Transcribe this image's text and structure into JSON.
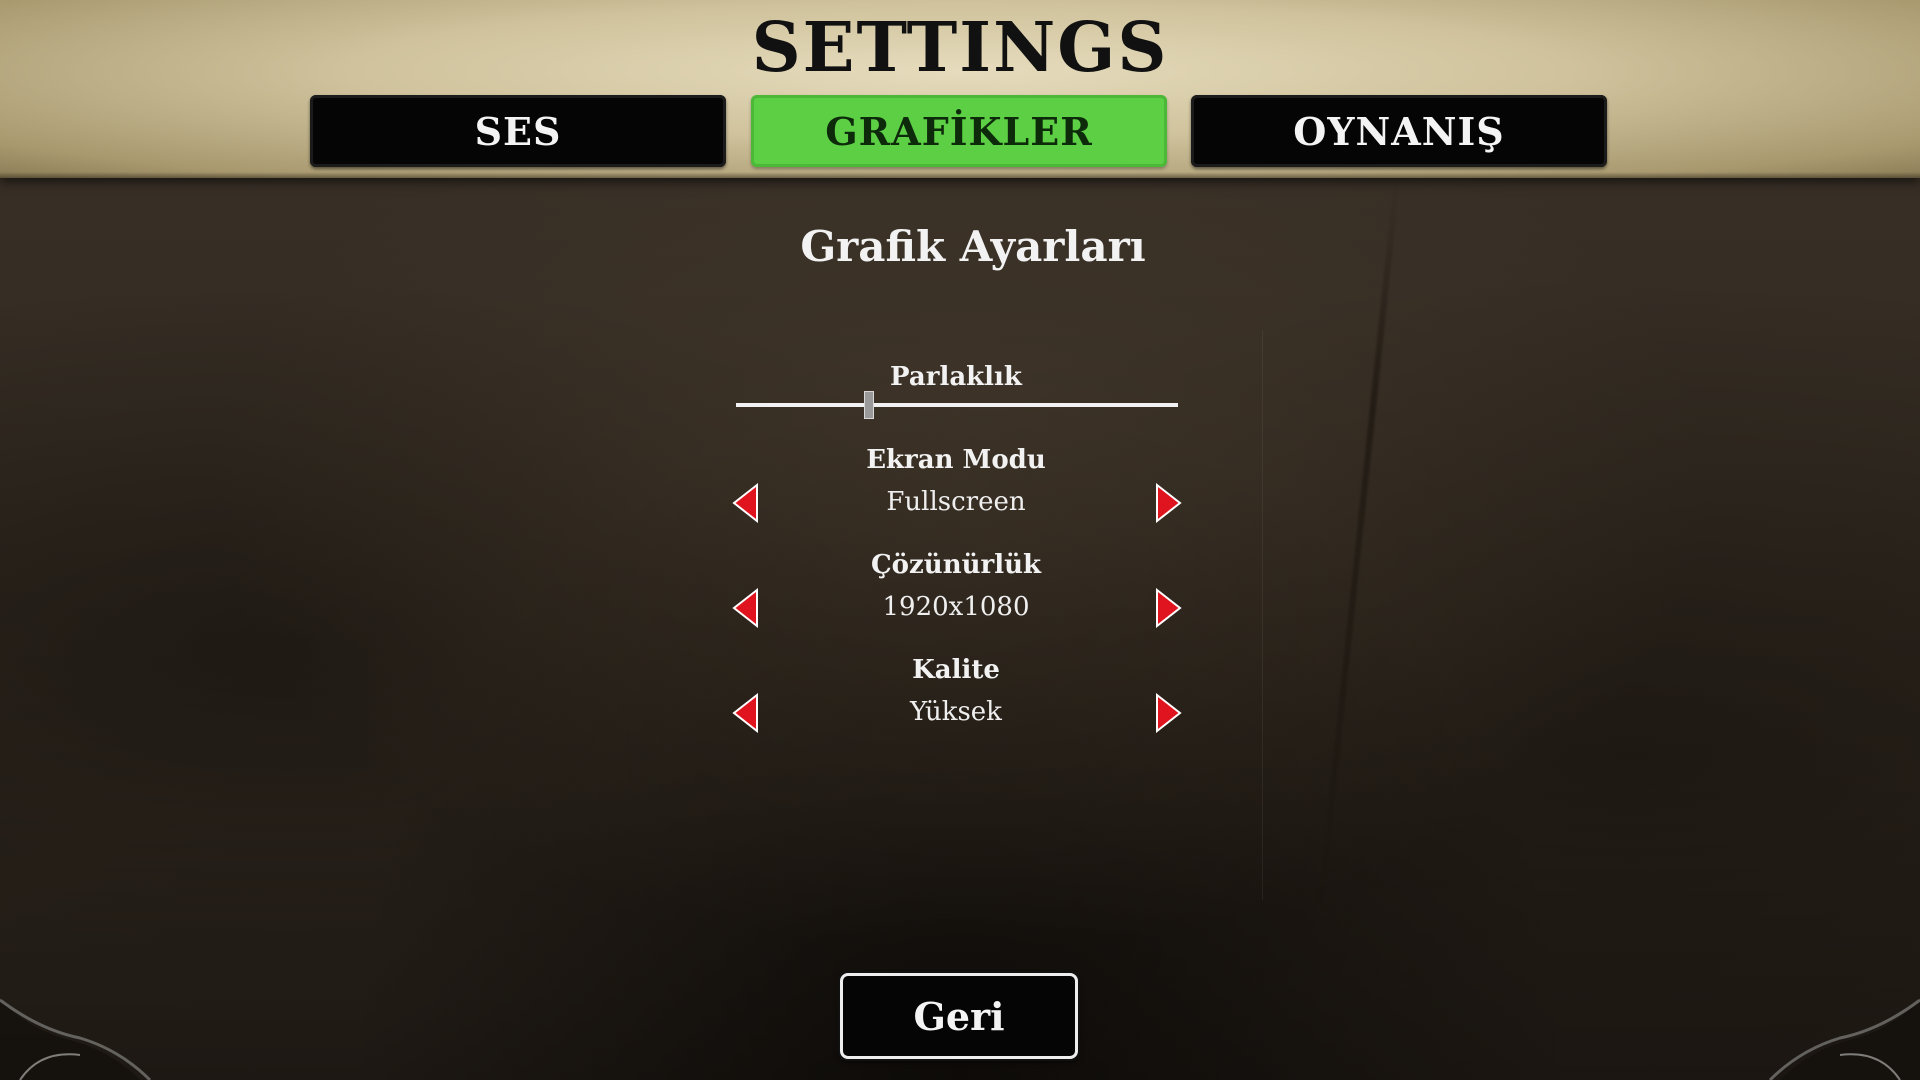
{
  "header": {
    "title": "SETTINGS",
    "tabs": [
      {
        "label": "SES",
        "active": false
      },
      {
        "label": "GRAFİKLER",
        "active": true
      },
      {
        "label": "OYNANIŞ",
        "active": false
      }
    ]
  },
  "graphics": {
    "section_title": "Grafik Ayarları",
    "brightness": {
      "label": "Parlaklık",
      "value": 0.3
    },
    "screen_mode": {
      "label": "Ekran Modu",
      "value": "Fullscreen"
    },
    "resolution": {
      "label": "Çözünürlük",
      "value": "1920x1080"
    },
    "quality": {
      "label": "Kalite",
      "value": "Yüksek"
    }
  },
  "footer": {
    "back_label": "Geri"
  },
  "colors": {
    "active_tab": "#5ccf45",
    "arrow": "#e0141e",
    "header": "#cfc29c",
    "background": "#342c23"
  },
  "icons": {
    "prev": "triangle-left-icon",
    "next": "triangle-right-icon"
  }
}
